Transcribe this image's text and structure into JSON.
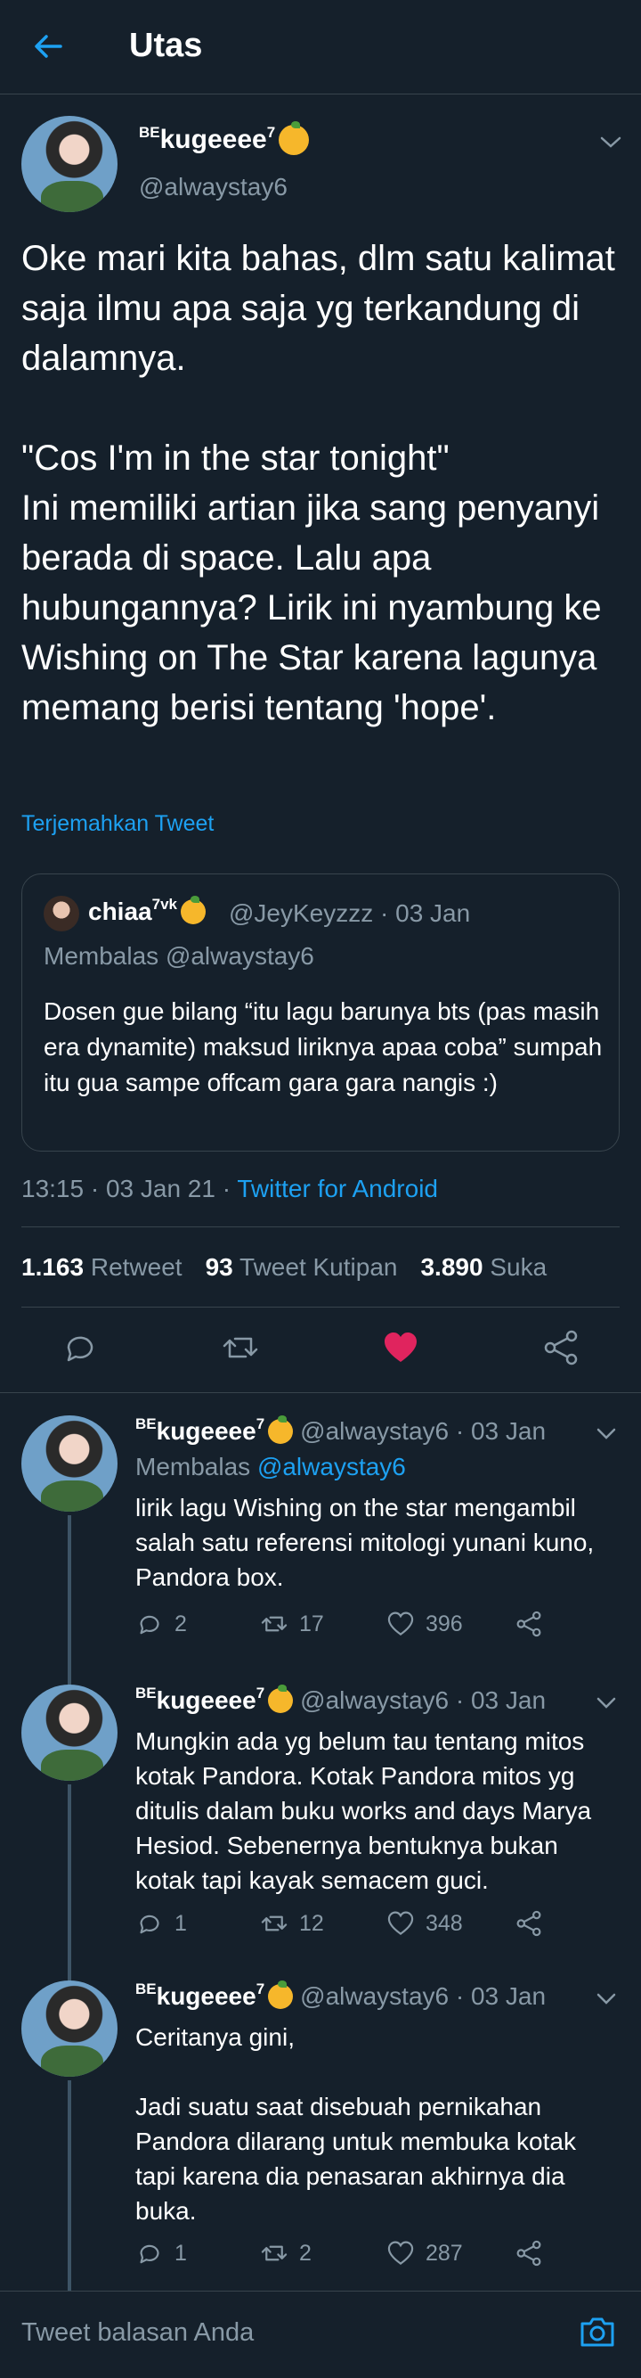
{
  "header": {
    "title": "Utas"
  },
  "main_tweet": {
    "name": "kugeeee",
    "name_prefix": "BE",
    "name_sup": "7",
    "handle": "@alwaystay6",
    "text": "Oke mari kita bahas, dlm satu kalimat saja ilmu apa saja yg terkandung di dalamnya.\n\n\"Cos I'm in the star tonight\"\nIni memiliki artian jika sang penyanyi berada di space. Lalu apa hubungannya? Lirik ini nyambung ke Wishing on The Star karena lagunya memang berisi tentang 'hope'.",
    "translate": "Terjemahkan Tweet",
    "quote": {
      "name": "chiaa",
      "name_sup": "7vk",
      "meta": "@JeyKeyzzz · 03 Jan",
      "replying": "Membalas @alwaystay6",
      "text": "Dosen gue bilang “itu lagu barunya bts (pas masih era dynamite) maksud liriknya apaa coba” sumpah itu gua sampe offcam gara gara nangis :)"
    },
    "timestamp": "13:15 · 03 Jan 21 · ",
    "source": "Twitter for Android",
    "stats": {
      "retweets_count": "1.163",
      "retweets_label": "Retweet",
      "quotes_count": "93",
      "quotes_label": "Tweet Kutipan",
      "likes_count": "3.890",
      "likes_label": "Suka"
    }
  },
  "replies": [
    {
      "name": "kugeeee",
      "name_prefix": "BE",
      "name_sup": "7",
      "meta": "@alwaystay6 · 03 Jan",
      "replying_prefix": "Membalas ",
      "replying_handle": "@alwaystay6",
      "text": "lirik lagu Wishing on the star mengambil salah satu referensi mitologi yunani kuno, Pandora box.",
      "reply_count": "2",
      "retweet_count": "17",
      "like_count": "396"
    },
    {
      "name": "kugeeee",
      "name_prefix": "BE",
      "name_sup": "7",
      "meta": "@alwaystay6 · 03 Jan",
      "text": "Mungkin ada yg belum tau tentang mitos kotak Pandora. Kotak Pandora mitos yg ditulis dalam buku works and days Marya Hesiod. Sebenernya bentuknya bukan kotak tapi kayak semacem guci.",
      "reply_count": "1",
      "retweet_count": "12",
      "like_count": "348"
    },
    {
      "name": "kugeeee",
      "name_prefix": "BE",
      "name_sup": "7",
      "meta": "@alwaystay6 · 03 Jan",
      "text": "Ceritanya gini,\n\nJadi suatu saat disebuah pernikahan Pandora dilarang untuk membuka kotak tapi karena dia penasaran akhirnya dia buka.",
      "reply_count": "1",
      "retweet_count": "2",
      "like_count": "287"
    }
  ],
  "composer": {
    "placeholder": "Tweet balasan Anda"
  },
  "colors": {
    "background": "#15202b",
    "accent": "#1da1f2",
    "like": "#e0245e",
    "muted": "#8899a6",
    "divider": "#38444d"
  }
}
